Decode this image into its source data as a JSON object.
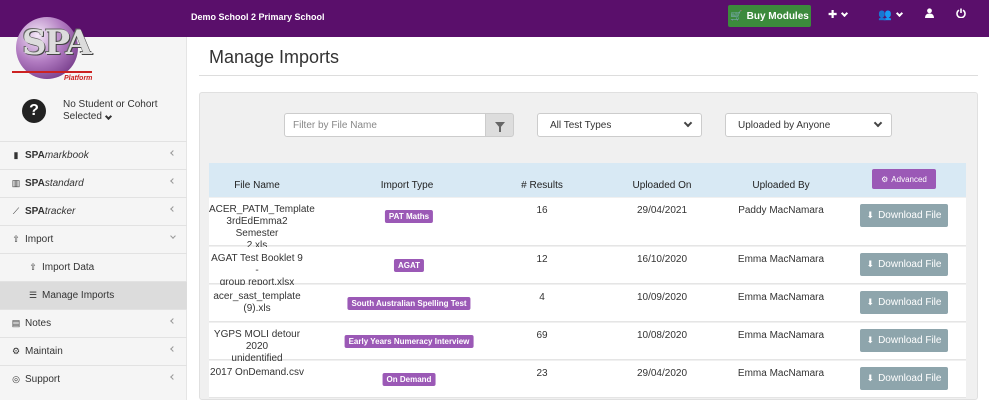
{
  "header": {
    "school_name": "Demo School 2 Primary School",
    "buy_modules_label": "Buy Modules"
  },
  "logo": {
    "text": "SPA",
    "sub": "Platform"
  },
  "sidebar": {
    "student_line1": "No Student or Cohort",
    "student_line2": "Selected",
    "items": [
      {
        "pre": "SPA",
        "post": "markbook"
      },
      {
        "pre": "SPA",
        "post": "standard"
      },
      {
        "pre": "SPA",
        "post": "tracker"
      },
      {
        "label": "Import"
      },
      {
        "label": "Import Data"
      },
      {
        "label": "Manage Imports"
      },
      {
        "label": "Notes"
      },
      {
        "label": "Maintain"
      },
      {
        "label": "Support"
      }
    ]
  },
  "page": {
    "title": "Manage Imports"
  },
  "filters": {
    "filename_placeholder": "Filter by File Name",
    "test_type": "All Test Types",
    "uploader": "Uploaded by Anyone"
  },
  "table": {
    "headers": [
      "File Name",
      "Import Type",
      "# Results",
      "Uploaded On",
      "Uploaded By"
    ],
    "advanced_label": "Advanced",
    "download_label": "Download File",
    "rows": [
      {
        "file_lines": [
          "ACER_PATM_Template",
          "3rdEdEmma2 Semester",
          "2.xls"
        ],
        "type": "PAT Maths",
        "results": "16",
        "date": "29/04/2021",
        "by": "Paddy MacNamara"
      },
      {
        "file_lines": [
          "AGAT Test Booklet 9 -",
          "group report.xlsx"
        ],
        "type": "AGAT",
        "results": "12",
        "date": "16/10/2020",
        "by": "Emma MacNamara"
      },
      {
        "file_lines": [
          "acer_sast_template (9).xls"
        ],
        "type": "South Australian Spelling Test",
        "results": "4",
        "date": "10/09/2020",
        "by": "Emma MacNamara"
      },
      {
        "file_lines": [
          "YGPS MOLI detour 2020",
          "unidentified (Fixed).xlsx"
        ],
        "type": "Early Years Numeracy Interview",
        "results": "69",
        "date": "10/08/2020",
        "by": "Emma MacNamara"
      },
      {
        "file_lines": [
          "2017 OnDemand.csv"
        ],
        "type": "On Demand",
        "results": "23",
        "date": "29/04/2020",
        "by": "Emma MacNamara"
      }
    ]
  },
  "colors": {
    "header": "#5a0f6b",
    "accent": "#9b59b6",
    "buy": "#3c8a3c",
    "download": "#8ea5ac",
    "table_head": "#d8e9f4"
  }
}
